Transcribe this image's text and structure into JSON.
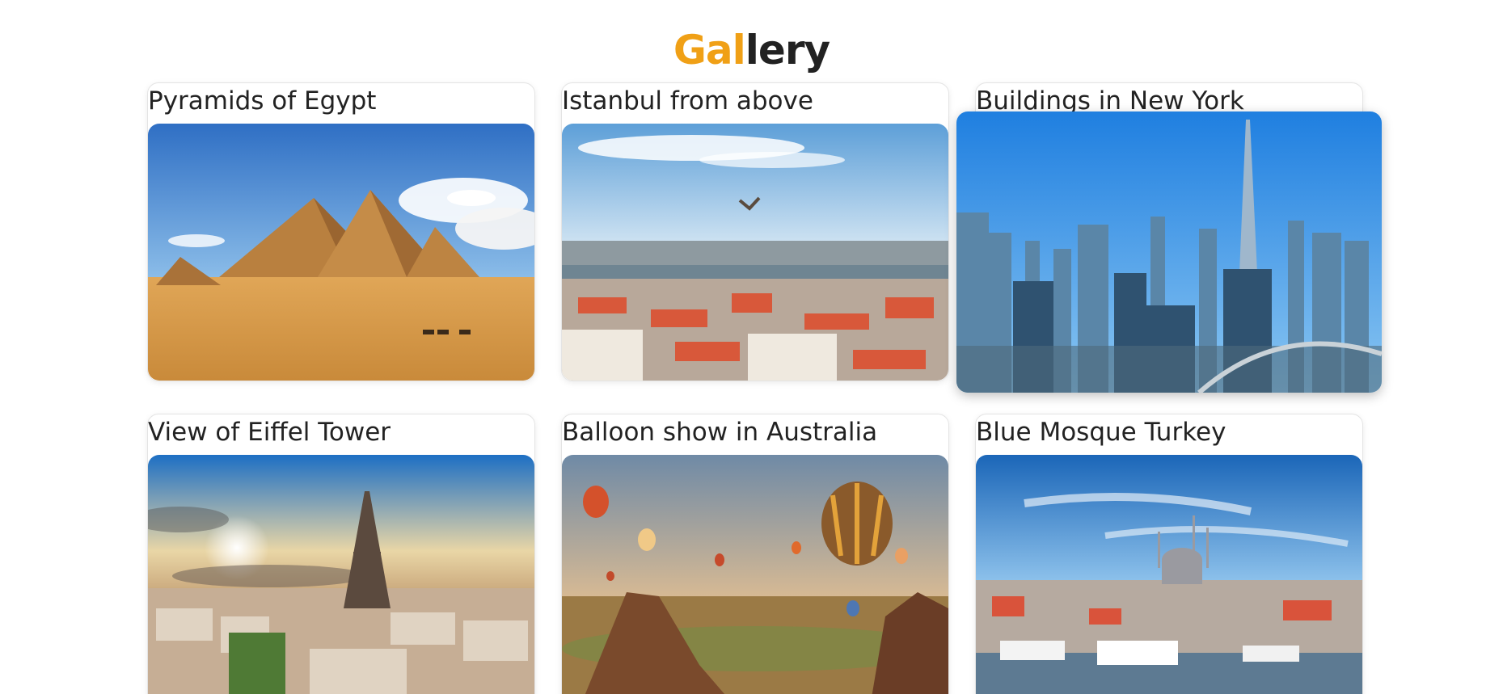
{
  "header": {
    "title_accent": "Gal",
    "title_rest": "lery"
  },
  "gallery": {
    "items": [
      {
        "caption": "Pyramids of Egypt",
        "image": "pyramids-photo"
      },
      {
        "caption": "Istanbul from above",
        "image": "istanbul-aerial-photo"
      },
      {
        "caption": "Buildings in New York",
        "image": "skyline-photo"
      },
      {
        "caption": "View of Eiffel Tower",
        "image": "eiffel-tower-photo"
      },
      {
        "caption": "Balloon show in Australia",
        "image": "balloons-photo"
      },
      {
        "caption": "Blue Mosque Turkey",
        "image": "blue-mosque-photo"
      }
    ]
  },
  "colors": {
    "accent": "#f0a016",
    "text": "#222222",
    "card_border": "#e4e4e4"
  }
}
